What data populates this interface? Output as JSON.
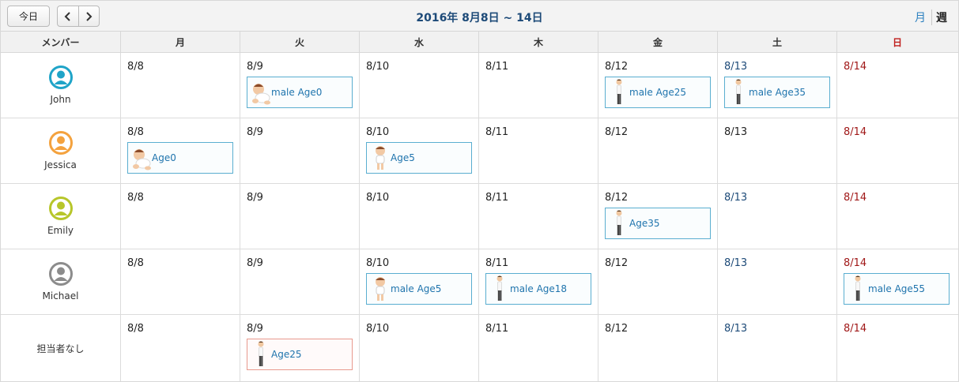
{
  "toolbar": {
    "today_label": "今日",
    "prev_icon": "chevron-left-icon",
    "next_icon": "chevron-right-icon",
    "title": "2016年 8月8日 ~ 14日",
    "view_month": "月",
    "view_week": "週"
  },
  "header": {
    "member_col": "メンバー",
    "days": [
      "月",
      "火",
      "水",
      "木",
      "金",
      "土",
      "日"
    ]
  },
  "colors": {
    "link": "#1f74ad",
    "title": "#1d4a78",
    "sunday": "#c0201e",
    "event_border": "#5aaed0",
    "event_border_alt": "#e89a8e"
  },
  "rows": [
    {
      "name": "John",
      "avatar_color": "#1fa4c8",
      "dates": [
        "8/8",
        "8/9",
        "8/10",
        "8/11",
        "8/12",
        "8/13",
        "8/14"
      ],
      "events": {
        "1": "male Age0",
        "4": "male Age25",
        "5": "male Age35"
      }
    },
    {
      "name": "Jessica",
      "avatar_color": "#f4a23e",
      "dates": [
        "8/8",
        "8/9",
        "8/10",
        "8/11",
        "8/12",
        "8/13",
        "8/14"
      ],
      "events": {
        "0": "Age0",
        "2": "Age5"
      }
    },
    {
      "name": "Emily",
      "avatar_color": "#b7c62a",
      "dates": [
        "8/8",
        "8/9",
        "8/10",
        "8/11",
        "8/12",
        "8/13",
        "8/14"
      ],
      "events": {
        "4": "Age35"
      }
    },
    {
      "name": "Michael",
      "avatar_color": "#8c8c8c",
      "dates": [
        "8/8",
        "8/9",
        "8/10",
        "8/11",
        "8/12",
        "8/13",
        "8/14"
      ],
      "events": {
        "2": "male Age5",
        "3": "male Age18",
        "6": "male Age55"
      }
    },
    {
      "name": "担当者なし",
      "avatar_color": "",
      "dates": [
        "8/8",
        "8/9",
        "8/10",
        "8/11",
        "8/12",
        "8/13",
        "8/14"
      ],
      "events": {
        "1": "Age25"
      }
    }
  ]
}
